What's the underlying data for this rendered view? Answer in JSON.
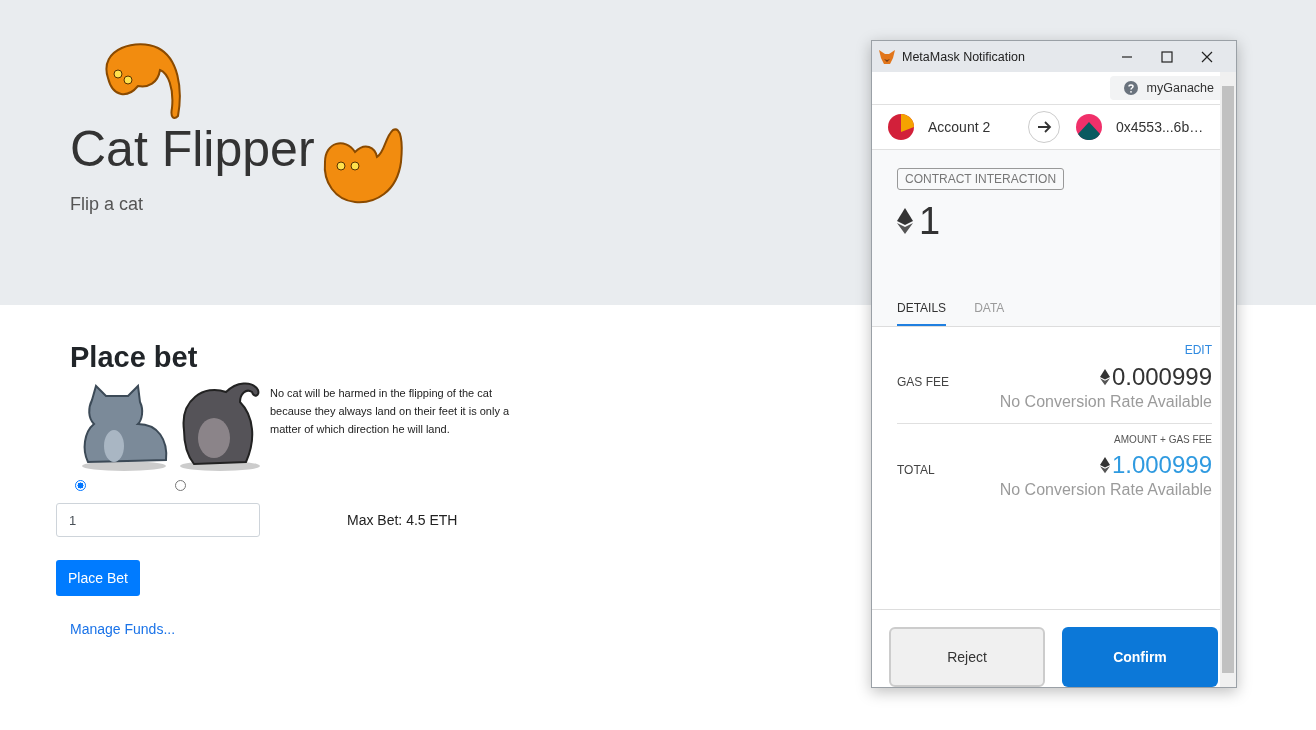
{
  "page": {
    "title": "Cat Flipper",
    "subtitle": "Flip a cat"
  },
  "bet": {
    "heading": "Place bet",
    "description": "No cat will be harmed in the flipping of the cat because they always land on their feet it is only a matter of which direction he will land.",
    "choices": [
      {
        "kind": "sitting",
        "selected": true
      },
      {
        "kind": "back",
        "selected": false
      }
    ],
    "amount": "1",
    "max_bet": "Max Bet: 4.5 ETH",
    "button": "Place Bet",
    "link": "Manage Funds..."
  },
  "popup": {
    "title": "MetaMask Notification",
    "network": "myGanache",
    "from": "Account 2",
    "to": "0x4553...6b…",
    "badge": "CONTRACT INTERACTION",
    "amount": "1",
    "tabs": [
      {
        "label": "DETAILS",
        "selected": true
      },
      {
        "label": "DATA",
        "selected": false
      }
    ],
    "edit": "EDIT",
    "gas": {
      "label": "GAS FEE",
      "value": "0.000999",
      "conversion": "No Conversion Rate Available"
    },
    "total": {
      "label": "TOTAL",
      "hint": "AMOUNT + GAS FEE",
      "value": "1.000999",
      "conversion": "No Conversion Rate Available"
    },
    "buttons": {
      "reject": "Reject",
      "confirm": "Confirm"
    }
  }
}
